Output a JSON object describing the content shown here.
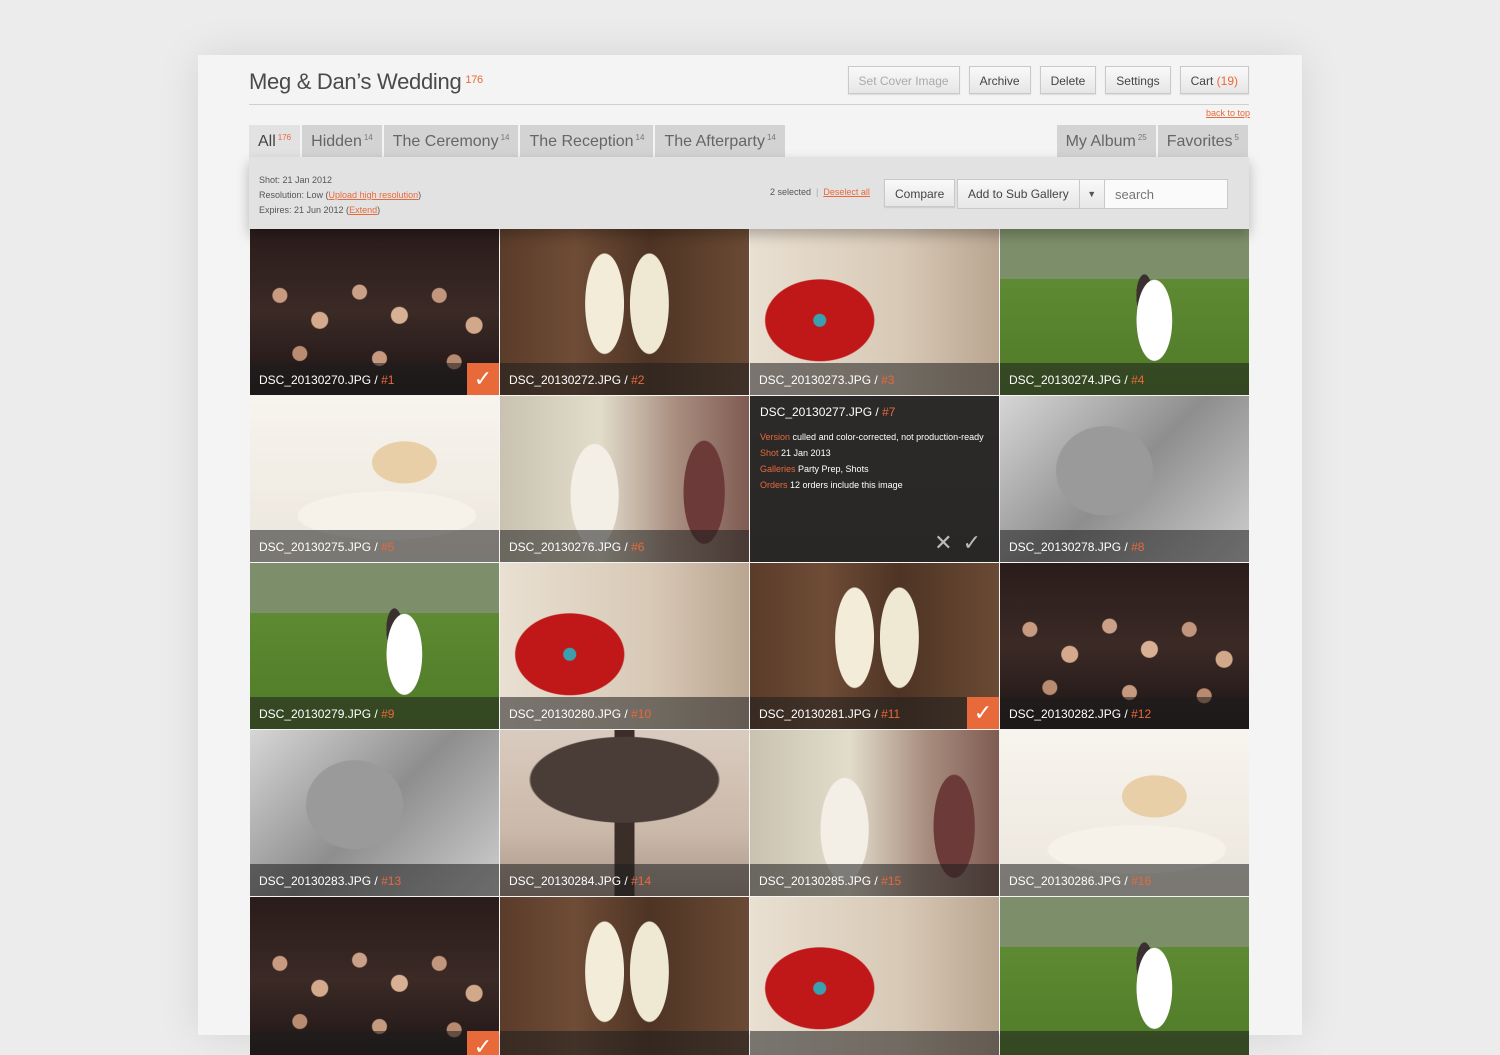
{
  "header": {
    "title": "Meg & Dan’s Wedding",
    "title_count": "176",
    "buttons": {
      "set_cover": "Set Cover Image",
      "archive": "Archive",
      "delete": "Delete",
      "settings": "Settings",
      "cart": "Cart",
      "cart_count": "(19)"
    },
    "back_to_top": "back to top"
  },
  "tabs_left": [
    {
      "label": "All",
      "count": "176",
      "active": true
    },
    {
      "label": "Hidden",
      "count": "14"
    },
    {
      "label": "The Ceremony",
      "count": "14"
    },
    {
      "label": "The Reception",
      "count": "14"
    },
    {
      "label": "The Afterparty",
      "count": "14"
    }
  ],
  "tabs_right": [
    {
      "label": "My Album",
      "count": "25"
    },
    {
      "label": "Favorites",
      "count": "5"
    }
  ],
  "toolbar": {
    "shot_label": "Shot: 21 Jan 2012",
    "resolution_label": "Resolution: Low (",
    "upload_link": "Upload high resolution",
    "resolution_close": ")",
    "expires_label": "Expires: 21 Jun 2012 (",
    "extend_link": "Extend",
    "expires_close": ")",
    "selected": "2 selected",
    "separator": "|",
    "deselect": "Deselect all",
    "compare": "Compare",
    "add_sub": "Add to Sub Gallery",
    "dropdown_arrow": "▼",
    "search_placeholder": "search"
  },
  "photos": [
    {
      "file": "DSC_20130270.JPG",
      "num": "#1",
      "scene": "crowd",
      "selected": true
    },
    {
      "file": "DSC_20130272.JPG",
      "num": "#2",
      "scene": "shoes"
    },
    {
      "file": "DSC_20130273.JPG",
      "num": "#3",
      "scene": "gift"
    },
    {
      "file": "DSC_20130274.JPG",
      "num": "#4",
      "scene": "grass"
    },
    {
      "file": "DSC_20130275.JPG",
      "num": "#5",
      "scene": "bride"
    },
    {
      "file": "DSC_20130276.JPG",
      "num": "#6",
      "scene": "shop"
    },
    {
      "file": "DSC_20130277.JPG",
      "num": "#7",
      "scene": "dark",
      "info": {
        "version_k": "Version",
        "version_v": "culled and color-corrected, not production-ready",
        "shot_k": "Shot",
        "shot_v": "21 Jan 2013",
        "galleries_k": "Galleries",
        "galleries_v": "Party Prep, Shots",
        "orders_k": "Orders",
        "orders_v": "12 orders include this image"
      }
    },
    {
      "file": "DSC_20130278.JPG",
      "num": "#8",
      "scene": "bw"
    },
    {
      "file": "DSC_20130279.JPG",
      "num": "#9",
      "scene": "grass"
    },
    {
      "file": "DSC_20130280.JPG",
      "num": "#10",
      "scene": "gift"
    },
    {
      "file": "DSC_20130281.JPG",
      "num": "#11",
      "scene": "shoes",
      "selected": true
    },
    {
      "file": "DSC_20130282.JPG",
      "num": "#12",
      "scene": "crowd"
    },
    {
      "file": "DSC_20130283.JPG",
      "num": "#13",
      "scene": "bw"
    },
    {
      "file": "DSC_20130284.JPG",
      "num": "#14",
      "scene": "tree"
    },
    {
      "file": "DSC_20130285.JPG",
      "num": "#15",
      "scene": "shop"
    },
    {
      "file": "DSC_20130286.JPG",
      "num": "#16",
      "scene": "bride"
    },
    {
      "file": "",
      "num": "",
      "scene": "crowd",
      "selected": true
    },
    {
      "file": "",
      "num": "",
      "scene": "shoes"
    },
    {
      "file": "",
      "num": "",
      "scene": "gift"
    },
    {
      "file": "",
      "num": "",
      "scene": "grass"
    }
  ],
  "colors": {
    "accent": "#e8693a",
    "tab_bg": "#d3d3d3",
    "toolbar_bg": "#e2e2e2"
  },
  "icons": {
    "check": "checkmark-icon",
    "close": "close-icon",
    "dropdown": "chevron-down-icon"
  }
}
